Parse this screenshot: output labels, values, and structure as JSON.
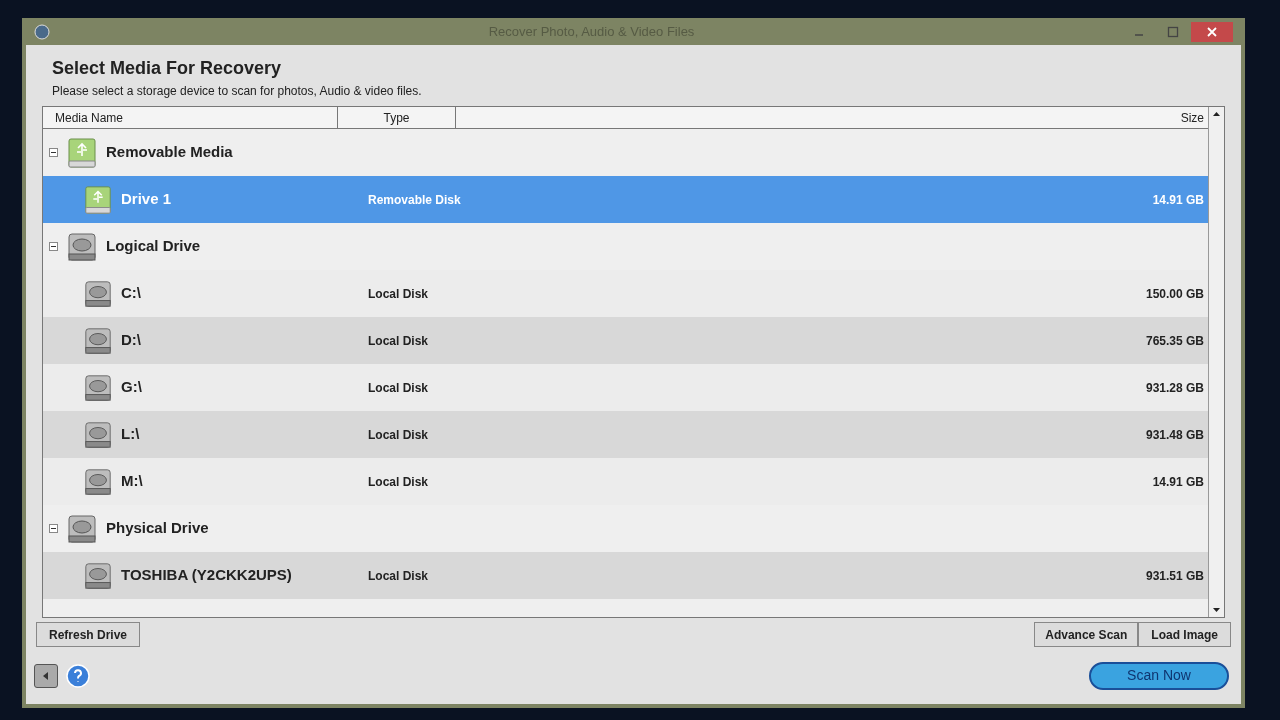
{
  "window": {
    "title": "Recover Photo, Audio & Video Files"
  },
  "header": {
    "title": "Select Media For Recovery",
    "subtitle": "Please select a storage device to scan for photos, Audio & video files."
  },
  "table": {
    "columns": [
      "Media Name",
      "Type",
      "Size"
    ],
    "groups": [
      {
        "name": "Removable Media",
        "kind": "removable",
        "expanded": true,
        "children": [
          {
            "name": "Drive 1",
            "type": "Removable Disk",
            "size": "14.91 GB",
            "selected": true
          }
        ]
      },
      {
        "name": "Logical Drive",
        "kind": "disk",
        "expanded": true,
        "children": [
          {
            "name": "C:\\",
            "type": "Local Disk",
            "size": "150.00 GB",
            "selected": false
          },
          {
            "name": "D:\\",
            "type": "Local Disk",
            "size": "765.35 GB",
            "selected": false
          },
          {
            "name": "G:\\",
            "type": "Local Disk",
            "size": "931.28 GB",
            "selected": false
          },
          {
            "name": "L:\\",
            "type": "Local Disk",
            "size": "931.48 GB",
            "selected": false
          },
          {
            "name": "M:\\",
            "type": "Local Disk",
            "size": "14.91 GB",
            "selected": false
          }
        ]
      },
      {
        "name": "Physical Drive",
        "kind": "disk",
        "expanded": true,
        "children": [
          {
            "name": "TOSHIBA (Y2CKK2UPS)",
            "type": "Local Disk",
            "size": "931.51 GB",
            "selected": false
          }
        ]
      }
    ]
  },
  "buttons": {
    "refresh": "Refresh Drive",
    "advance": "Advance Scan",
    "load": "Load Image",
    "scan": "Scan Now"
  }
}
